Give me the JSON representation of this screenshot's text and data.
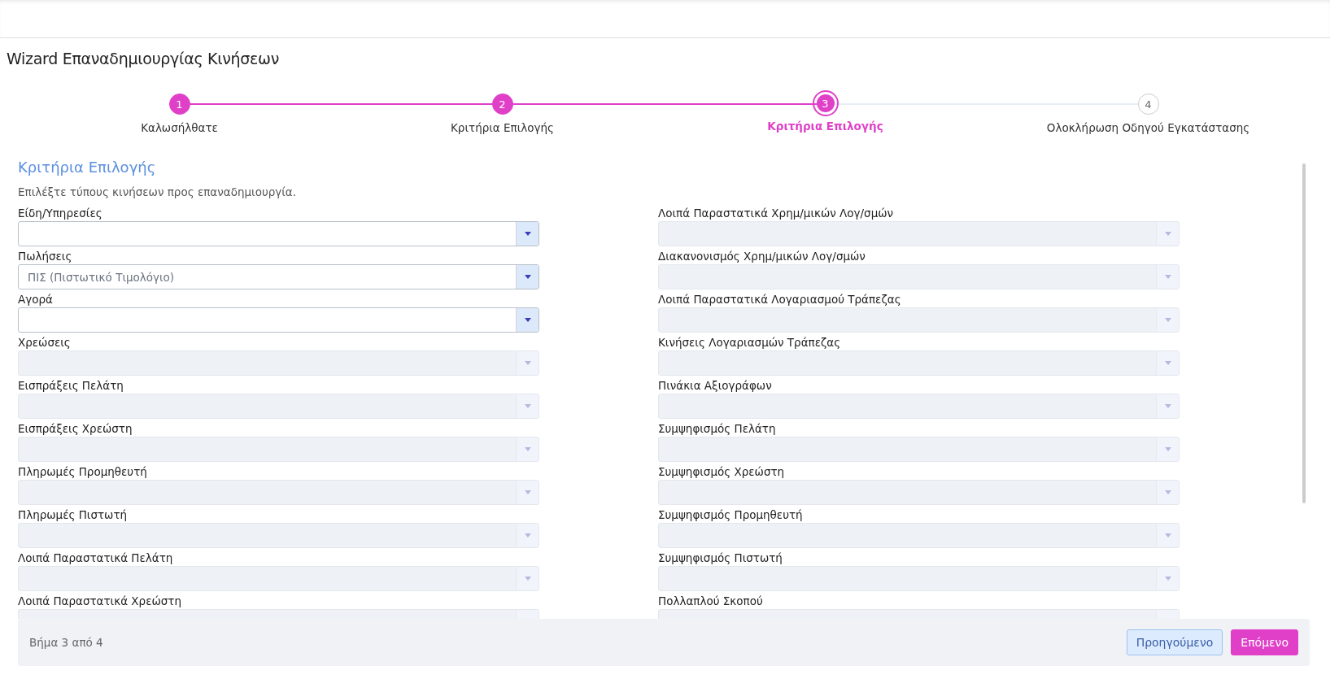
{
  "title": "Wizard Επαναδημιουργίας Κινήσεων",
  "steps": [
    {
      "number": "1",
      "label": "Καλωσήλθατε",
      "completed": true,
      "selected": false
    },
    {
      "number": "2",
      "label": "Κριτήρια Επιλογής",
      "completed": true,
      "selected": false
    },
    {
      "number": "3",
      "label": "Κριτήρια Επιλογής",
      "completed": false,
      "selected": true
    },
    {
      "number": "4",
      "label": "Ολοκλήρωση Οδηγού Εγκατάστασης",
      "completed": false,
      "selected": false
    }
  ],
  "section": {
    "title": "Κριτήρια Επιλογής",
    "description": "Επιλέξτε τύπους κινήσεων προς επαναδημιουργία."
  },
  "left_fields": [
    {
      "label": "Είδη/Υπηρεσίες",
      "disabled": false
    },
    {
      "label": "Πωλήσεις",
      "value": "ΠΙΣ (Πιστωτικό Τιμολόγιο)",
      "disabled": false
    },
    {
      "label": "Αγορά",
      "disabled": false
    },
    {
      "label": "Χρεώσεις",
      "disabled": true
    },
    {
      "label": "Εισπράξεις Πελάτη",
      "disabled": true
    },
    {
      "label": "Εισπράξεις Χρεώστη",
      "disabled": true
    },
    {
      "label": "Πληρωμές Προμηθευτή",
      "disabled": true
    },
    {
      "label": "Πληρωμές Πιστωτή",
      "disabled": true
    },
    {
      "label": "Λοιπά Παραστατικά Πελάτη",
      "disabled": true
    },
    {
      "label": "Λοιπά Παραστατικά Χρεώστη",
      "disabled": true
    }
  ],
  "right_fields": [
    {
      "label": "Λοιπά Παραστατικά Χρημ/μικών Λογ/σμών",
      "disabled": true
    },
    {
      "label": "Διακανονισμός Χρημ/μικών Λογ/σμών",
      "disabled": true
    },
    {
      "label": "Λοιπά Παραστατικά Λογαριασμού Τράπεζας",
      "disabled": true
    },
    {
      "label": "Κινήσεις Λογαριασμών Τράπεζας",
      "disabled": true
    },
    {
      "label": "Πινάκια Αξιογράφων",
      "disabled": true
    },
    {
      "label": "Συμψηφισμός Πελάτη",
      "disabled": true
    },
    {
      "label": "Συμψηφισμός Χρεώστη",
      "disabled": true
    },
    {
      "label": "Συμψηφισμός Προμηθευτή",
      "disabled": true
    },
    {
      "label": "Συμψηφισμός Πιστωτή",
      "disabled": true
    },
    {
      "label": "Πολλαπλού Σκοπού",
      "disabled": true
    }
  ],
  "footer": {
    "step_text": "Βήμα 3 από 4",
    "buttons": [
      {
        "label": "Προηγούμενο",
        "kind": "secondary"
      },
      {
        "label": "Επόμενο",
        "kind": "primary"
      }
    ]
  }
}
